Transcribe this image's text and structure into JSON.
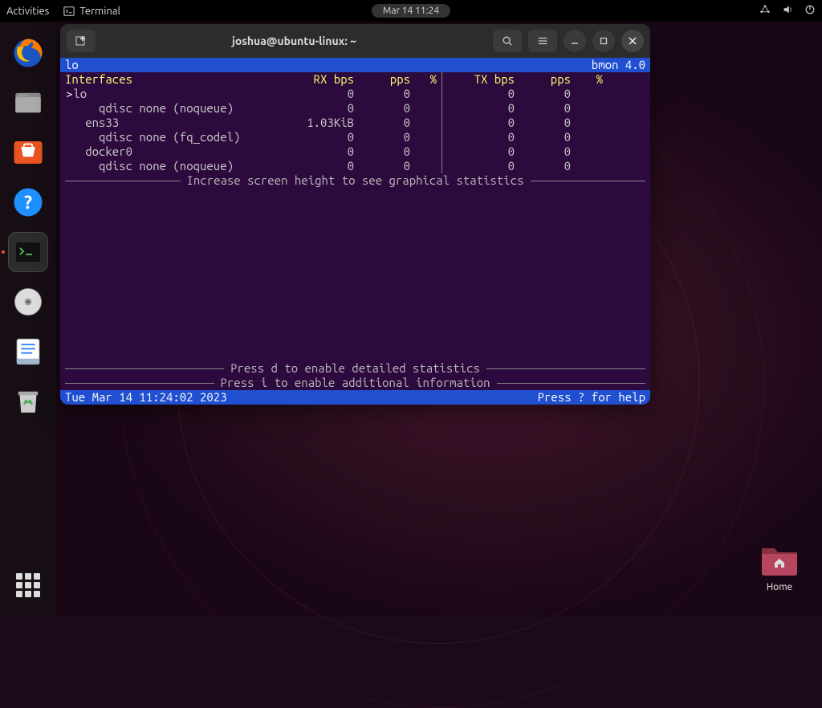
{
  "topbar": {
    "activities": "Activities",
    "app_name": "Terminal",
    "clock": "Mar 14  11:24"
  },
  "dock": {
    "items": [
      "firefox",
      "files",
      "software",
      "help",
      "terminal",
      "disk",
      "text-editor",
      "trash"
    ]
  },
  "desktop": {
    "home_label": "Home"
  },
  "window": {
    "title": "joshua@ubuntu-linux: ~"
  },
  "bmon": {
    "header_left": "lo",
    "header_right": "bmon 4.0",
    "columns": {
      "interfaces": "Interfaces",
      "rx": "RX bps",
      "pps1": "pps",
      "pct1": "%",
      "tx": "TX bps",
      "pps2": "pps",
      "pct2": "%"
    },
    "rows": [
      {
        "name": "lo",
        "indent": 0,
        "selected": true,
        "rx": "0",
        "pps1": "0",
        "pct1": "",
        "tx": "0",
        "pps2": "0",
        "pct2": ""
      },
      {
        "name": "qdisc none (noqueue)",
        "indent": 2,
        "selected": false,
        "rx": "0",
        "pps1": "0",
        "pct1": "",
        "tx": "0",
        "pps2": "0",
        "pct2": ""
      },
      {
        "name": "ens33",
        "indent": 1,
        "selected": false,
        "rx": "1.03KiB",
        "pps1": "0",
        "pct1": "",
        "tx": "0",
        "pps2": "0",
        "pct2": ""
      },
      {
        "name": "qdisc none (fq_codel)",
        "indent": 2,
        "selected": false,
        "rx": "0",
        "pps1": "0",
        "pct1": "",
        "tx": "0",
        "pps2": "0",
        "pct2": ""
      },
      {
        "name": "docker0",
        "indent": 1,
        "selected": false,
        "rx": "0",
        "pps1": "0",
        "pct1": "",
        "tx": "0",
        "pps2": "0",
        "pct2": ""
      },
      {
        "name": "qdisc none (noqueue)",
        "indent": 2,
        "selected": false,
        "rx": "0",
        "pps1": "0",
        "pct1": "",
        "tx": "0",
        "pps2": "0",
        "pct2": ""
      }
    ],
    "increase_msg": "Increase screen height to see graphical statistics",
    "hint_d": "Press d to enable detailed statistics",
    "hint_i": "Press i to enable additional information",
    "status_left": "Tue Mar 14 11:24:02 2023",
    "status_right": "Press ? for help"
  }
}
